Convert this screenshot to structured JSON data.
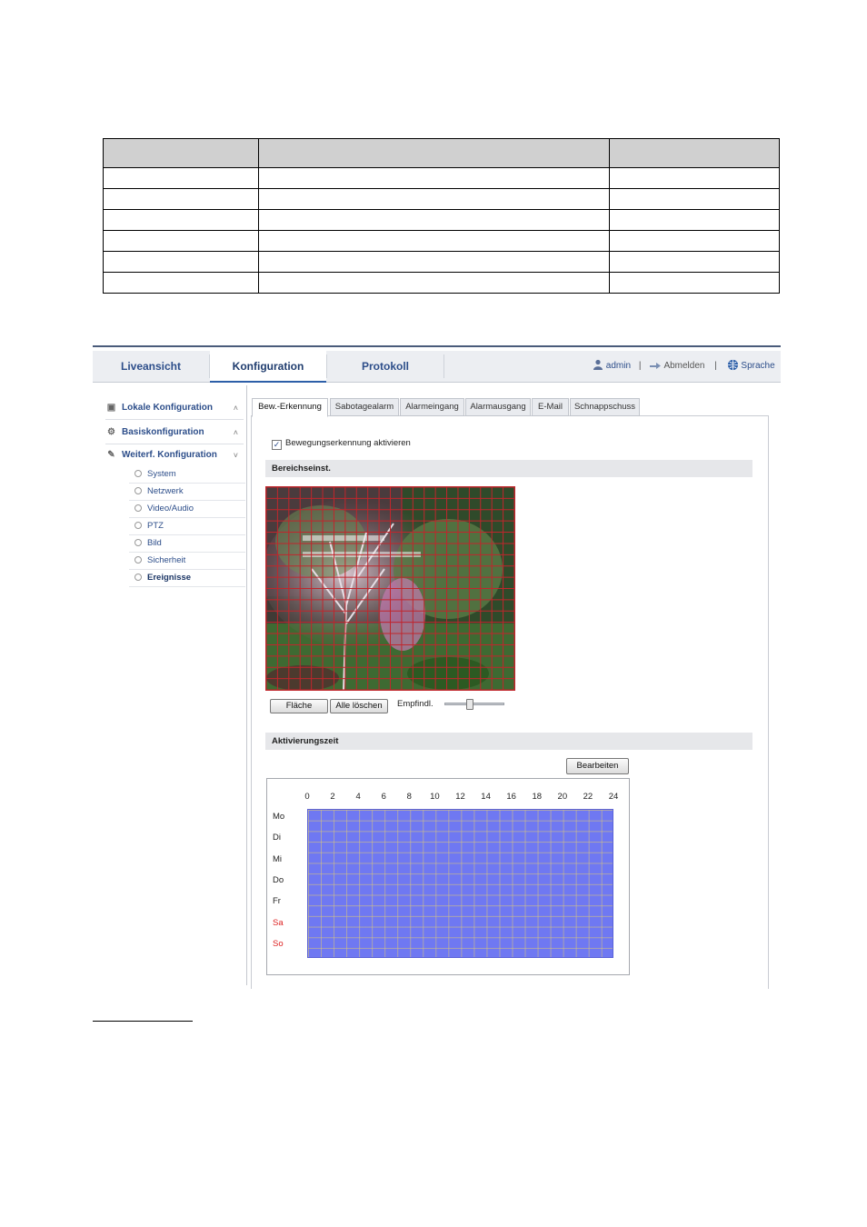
{
  "nav": {
    "tabs": [
      {
        "label": "Liveansicht"
      },
      {
        "label": "Konfiguration"
      },
      {
        "label": "Protokoll"
      }
    ],
    "user": "admin",
    "logout": "Abmelden",
    "language": "Sprache"
  },
  "sidebar": {
    "groups": [
      {
        "label": "Lokale Konfiguration",
        "icon": "monitor-icon"
      },
      {
        "label": "Basiskonfiguration",
        "icon": "gear-icon"
      },
      {
        "label": "Weiterf. Konfiguration",
        "icon": "wrench-icon"
      }
    ],
    "sub_items": [
      {
        "label": "System"
      },
      {
        "label": "Netzwerk"
      },
      {
        "label": "Video/Audio"
      },
      {
        "label": "PTZ"
      },
      {
        "label": "Bild"
      },
      {
        "label": "Sicherheit"
      },
      {
        "label": "Ereignisse"
      }
    ]
  },
  "subtabs": [
    {
      "label": "Bew.-Erkennung"
    },
    {
      "label": "Sabotagealarm"
    },
    {
      "label": "Alarmeingang"
    },
    {
      "label": "Alarmausgang"
    },
    {
      "label": "E-Mail"
    },
    {
      "label": "Schnappschuss"
    }
  ],
  "motion": {
    "enable_label": "Bewegungserkennung aktivieren",
    "enabled": true,
    "area_section": "Bereichseinst.",
    "area_button": "Fläche",
    "clear_button": "Alle löschen",
    "sensitivity_label": "Empfindl.",
    "sensitivity_level": 0.4
  },
  "schedule": {
    "section": "Aktivierungszeit",
    "edit_button": "Bearbeiten",
    "hours": [
      "0",
      "2",
      "4",
      "6",
      "8",
      "10",
      "12",
      "14",
      "16",
      "18",
      "20",
      "22",
      "24"
    ],
    "days": [
      "Mo",
      "Di",
      "Mi",
      "Do",
      "Fr",
      "Sa",
      "So"
    ],
    "weekend_color": "#dd2222",
    "fill_color": "#6f78f2"
  },
  "colors": {
    "accent": "#2d4e8a",
    "grid_line": "#c0262c"
  }
}
